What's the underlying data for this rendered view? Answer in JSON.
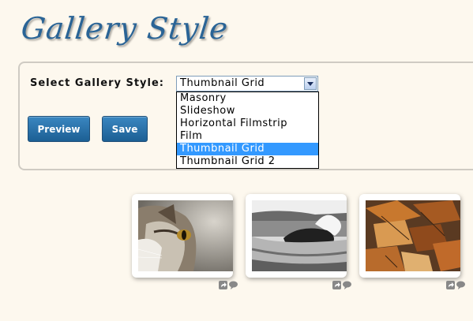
{
  "page": {
    "title": "Gallery Style"
  },
  "form": {
    "label": "Select Gallery Style:",
    "selected_value": "Thumbnail Grid",
    "options": [
      "Masonry",
      "Slideshow",
      "Horizontal Filmstrip",
      "Film",
      "Thumbnail Grid",
      "Thumbnail Grid 2"
    ],
    "selected_index": 4,
    "preview_label": "Preview",
    "save_label": "Save"
  },
  "gallery": {
    "thumbnails": [
      {
        "subject": "cat",
        "icons": [
          "share-icon",
          "comment-icon"
        ]
      },
      {
        "subject": "ocean-rock",
        "icons": [
          "share-icon",
          "comment-icon"
        ]
      },
      {
        "subject": "autumn-leaves",
        "icons": [
          "share-icon",
          "comment-icon"
        ]
      }
    ]
  },
  "colors": {
    "background": "#fdf8ee",
    "title": "#2a6496",
    "button": "#1c5f94",
    "selected_option": "#3399ff"
  }
}
